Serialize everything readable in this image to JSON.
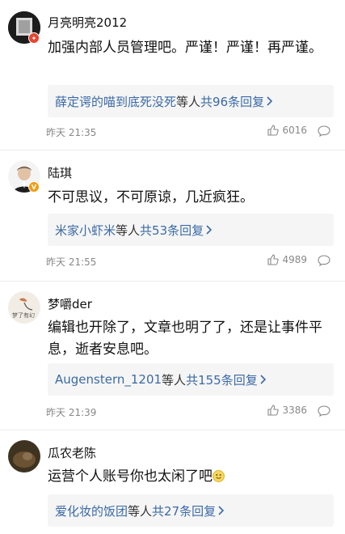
{
  "comments": [
    {
      "username": "月亮明亮2012",
      "text": "加强内部人员管理吧。严谨！严谨！再严谨。",
      "reply_name": "薛定谔的喵到底死没死",
      "reply_mid": "等人 ",
      "reply_count": "共96条回复",
      "time": "昨天 21:35",
      "likes": "6016",
      "avatar_color": "#222222",
      "badge_color": "#e8432e"
    },
    {
      "username": "陆琪",
      "text": "不可思议，不可原谅，几近疯狂。",
      "reply_name": "米家小虾米",
      "reply_mid": "等人 ",
      "reply_count": "共53条回复",
      "time": "昨天 21:55",
      "likes": "4989",
      "avatar_color": "#3a3a3a",
      "badge_color": "#f39c12"
    },
    {
      "username": "梦嚼der",
      "text": "编辑也开除了，文章也明了了，还是让事件平息，逝者安息吧。",
      "reply_name": "Augenstern_1201",
      "reply_mid": "等人 ",
      "reply_count": "共155条回复",
      "time": "昨天 21:39",
      "likes": "3386",
      "avatar_color": "#f2ede4",
      "avatar_text": "梦了有幻"
    },
    {
      "username": "瓜农老陈",
      "text": "运营个人账号你也太闲了吧",
      "reply_name": "爱化妆的饭团",
      "reply_mid": "等人 ",
      "reply_count": "共27条回复",
      "avatar_color": "#4a3a22"
    }
  ],
  "icons": {
    "like": "thumbs-up-icon",
    "comment": "comment-icon",
    "arrow": "chevron-right-icon"
  }
}
